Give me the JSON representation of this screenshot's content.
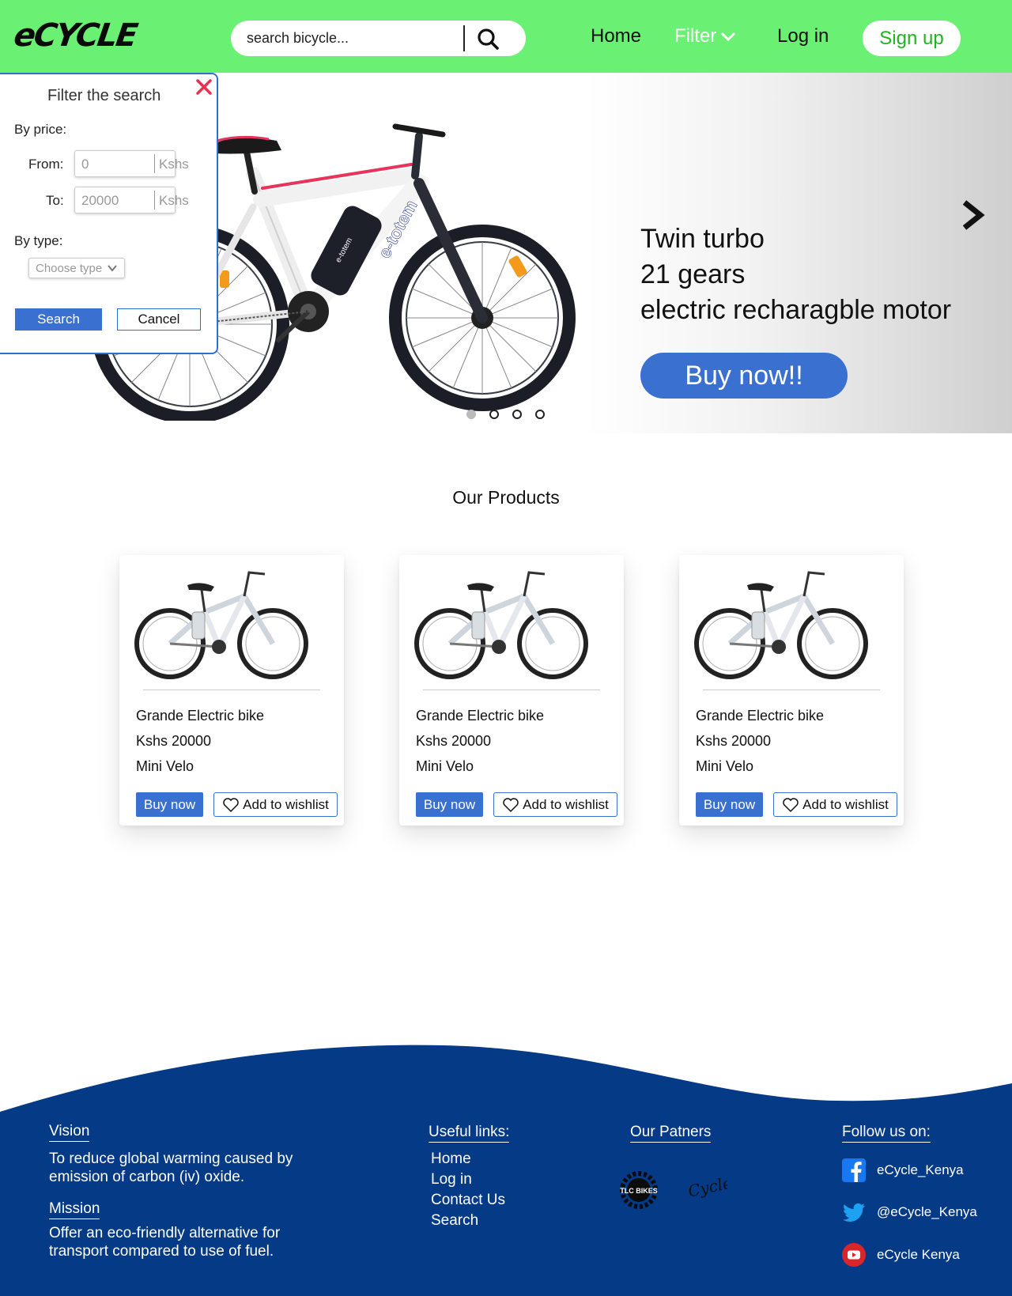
{
  "header": {
    "logo": "eCYCLE",
    "search_placeholder": "search bicycle...",
    "nav": {
      "home": "Home",
      "filter": "Filter",
      "login": "Log in",
      "signup": "Sign up"
    }
  },
  "filter_panel": {
    "title": "Filter the search",
    "by_price": "By price:",
    "from_label": "From:",
    "from_placeholder": "0",
    "to_label": "To:",
    "to_placeholder": "20000",
    "currency": "Kshs",
    "by_type": "By type:",
    "type_placeholder": "Choose type",
    "search_button": "Search",
    "cancel_button": "Cancel"
  },
  "hero": {
    "lines": [
      "Twin turbo",
      "21 gears",
      "electric recharagble motor"
    ],
    "cta": "Buy now!!",
    "slide_count": 4,
    "active_slide": 1,
    "brand_on_bike": "e-totem"
  },
  "products": {
    "title": "Our Products",
    "items": [
      {
        "name": "Grande Electric bike",
        "price": "Kshs 20000",
        "type": "Mini Velo",
        "buy": "Buy now",
        "wishlist": "Add to wishlist"
      },
      {
        "name": "Grande Electric bike",
        "price": "Kshs 20000",
        "type": "Mini Velo",
        "buy": "Buy now",
        "wishlist": "Add to wishlist"
      },
      {
        "name": "Grande Electric bike",
        "price": "Kshs 20000",
        "type": "Mini Velo",
        "buy": "Buy now",
        "wishlist": "Add to wishlist"
      }
    ]
  },
  "footer": {
    "vision_heading": "Vision",
    "vision_text": "To reduce global warming caused by emission of carbon (iv) oxide.",
    "mission_heading": "Mission",
    "mission_text": "Offer an eco-friendly alternative for transport compared to use of fuel.",
    "links_heading": "Useful links:",
    "links": [
      "Home",
      "Log in",
      "Contact Us",
      "Search"
    ],
    "partners_heading": "Our Patners",
    "partners_logos": [
      "TLC BIKES",
      "Cycle"
    ],
    "follow_heading": "Follow us on:",
    "socials": [
      {
        "icon": "facebook-icon",
        "handle": "eCycle_Kenya"
      },
      {
        "icon": "twitter-icon",
        "handle": "@eCycle_Kenya"
      },
      {
        "icon": "youtube-icon",
        "handle": "eCycle Kenya"
      }
    ]
  },
  "colors": {
    "header_green": "#6af072",
    "accent_blue": "#3a70cf",
    "footer_navy": "#053a86",
    "signup_green": "#21b321",
    "close_red": "#e8324c"
  }
}
